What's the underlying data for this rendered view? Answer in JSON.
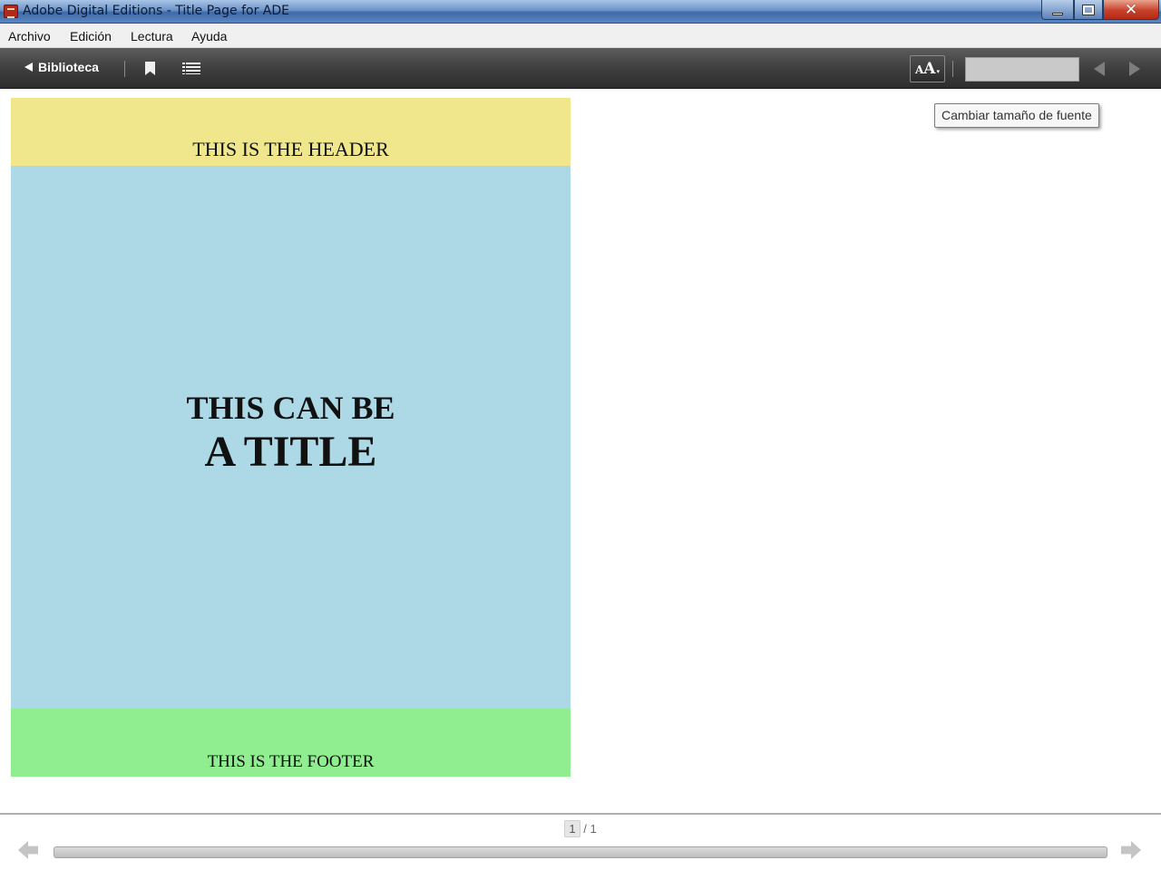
{
  "window": {
    "title": "Adobe Digital Editions - Title Page for ADE",
    "minimize_glyph": "",
    "close_glyph": "✕"
  },
  "menu": {
    "items": [
      {
        "label": "Archivo"
      },
      {
        "label": "Edición"
      },
      {
        "label": "Lectura"
      },
      {
        "label": "Ayuda"
      }
    ]
  },
  "toolbar": {
    "library_label": "Biblioteca",
    "font_button_small": "A",
    "font_button_large": "A",
    "font_button_caret": "▾",
    "page_field_value": ""
  },
  "tooltip": {
    "text": "Cambiar tamaño de fuente"
  },
  "page": {
    "header_text": "THIS IS THE HEADER",
    "title_line1": "THIS CAN BE",
    "title_line2": "A TITLE",
    "footer_text": "THIS IS THE FOOTER",
    "colors": {
      "header": "#f0e68c",
      "body": "#add8e6",
      "footer": "#90ee90"
    }
  },
  "pagination": {
    "current": "1",
    "separator": "/",
    "total": "1"
  },
  "icons": [
    "app-icon",
    "minimize-icon",
    "maximize-icon",
    "close-icon",
    "back-arrow-icon",
    "bookmark-icon",
    "table-of-contents-icon",
    "font-size-icon",
    "previous-page-icon",
    "next-page-icon"
  ]
}
